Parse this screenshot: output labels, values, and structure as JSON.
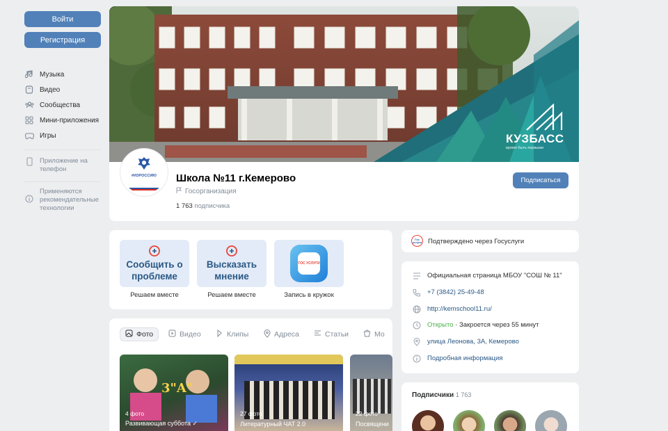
{
  "sidebar": {
    "login_label": "Войти",
    "register_label": "Регистрация",
    "items": [
      {
        "label": "Музыка",
        "icon": "music-note-icon"
      },
      {
        "label": "Видео",
        "icon": "video-icon"
      },
      {
        "label": "Сообщества",
        "icon": "people-icon"
      },
      {
        "label": "Мини-приложения",
        "icon": "apps-grid-icon"
      },
      {
        "label": "Игры",
        "icon": "gamepad-icon"
      }
    ],
    "app_label": "Приложение на телефон",
    "recommend_label": "Применяются рекомендательные технологии"
  },
  "cover": {
    "brand": "КУЗБАСС",
    "brand_sub": "время быть первыми",
    "brand_color": "#2aa6a0"
  },
  "group": {
    "avatar_text": "#ИЗРОССИЮ",
    "name": "Школа №11 г.Кемерово",
    "type": "Госорганизация",
    "followers_count": "1 763",
    "followers_word": "подписчика",
    "subscribe_label": "Подписаться"
  },
  "actions": [
    {
      "big": "Сообщить о проблеме",
      "caption": "Решаем вместе"
    },
    {
      "big": "Высказать мнение",
      "caption": "Решаем вместе"
    },
    {
      "big": "",
      "caption": "Запись в кружок",
      "icon_text": "ГОС УСЛУГИ"
    }
  ],
  "tabs": [
    {
      "label": "Фото",
      "icon": "photo-icon"
    },
    {
      "label": "Видео",
      "icon": "video-icon"
    },
    {
      "label": "Клипы",
      "icon": "clips-icon"
    },
    {
      "label": "Адреса",
      "icon": "location-pin-icon"
    },
    {
      "label": "Статьи",
      "icon": "article-icon"
    },
    {
      "label": "Мо",
      "icon": "market-icon"
    }
  ],
  "albums": [
    {
      "count": "4 фото",
      "title": "Развивающая суббота ✓"
    },
    {
      "count": "27 фото",
      "title": "Литературный ЧАТ 2.0"
    },
    {
      "count": "22 фото",
      "title": "Посвящени"
    }
  ],
  "verified": {
    "text": "Подтверждено через Госуслуги",
    "badge": "Гос услуги"
  },
  "info": {
    "description": "Официальная страница МБОУ \"СОШ № 11\"",
    "phone": "+7 (3842) 25-49-48",
    "site": "http://kemschool11.ru/",
    "open_label": "Открыто",
    "close_text": "· Закроется через 55 минут",
    "address": "улица Леонова, 3А, Кемерово",
    "more": "Подробная информация",
    "open_color": "#4bb34b"
  },
  "followers": {
    "title": "Подписчики",
    "count": "1 763"
  }
}
